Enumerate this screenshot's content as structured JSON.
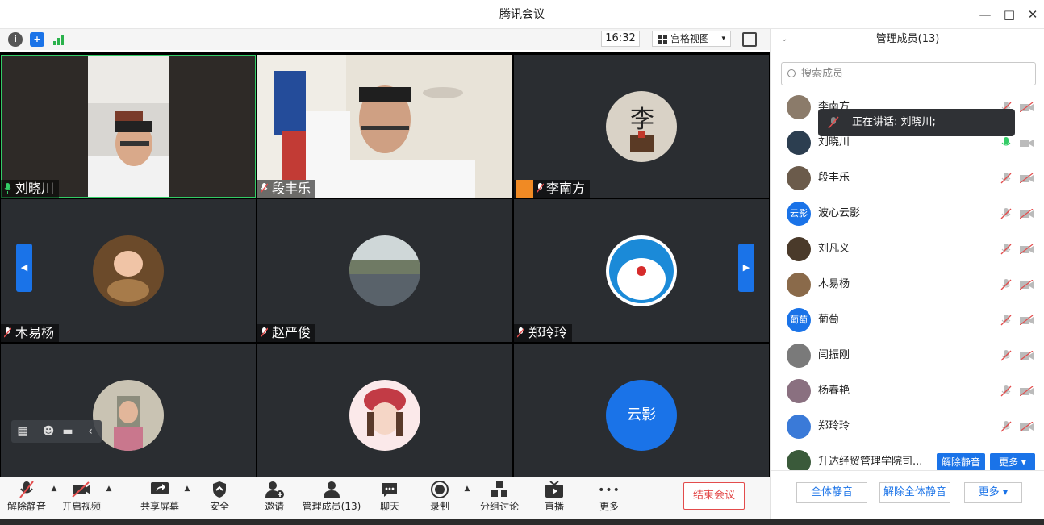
{
  "window": {
    "title": "腾讯会议",
    "minimize": "—",
    "maximize": "□",
    "close": "✕"
  },
  "topbar": {
    "time": "16:32",
    "view_label": "宫格视图",
    "view_caret": "▾"
  },
  "tiles": [
    {
      "name": "刘晓川",
      "active": true,
      "mic": "on"
    },
    {
      "name": "段丰乐",
      "active": false,
      "mic": "muted"
    },
    {
      "name": "李南方",
      "active": false,
      "mic": "muted",
      "badge": true
    },
    {
      "name": "木易杨",
      "active": false,
      "mic": "muted"
    },
    {
      "name": "赵严俊",
      "active": false,
      "mic": "muted"
    },
    {
      "name": "郑玲玲",
      "active": false,
      "mic": "muted"
    },
    {
      "name": "",
      "active": false,
      "mic": "muted"
    },
    {
      "name": "",
      "active": false,
      "mic": "muted"
    },
    {
      "name": "云影",
      "active": false,
      "mic": "muted"
    }
  ],
  "nav": {
    "prev": "◀",
    "next": "▶"
  },
  "toolbar": {
    "unmute": "解除静音",
    "start_video": "开启视频",
    "share": "共享屏幕",
    "security": "安全",
    "invite": "邀请",
    "members": "管理成员(13)",
    "chat": "聊天",
    "record": "录制",
    "breakout": "分组讨论",
    "live": "直播",
    "more": "更多",
    "end": "结束会议",
    "more_dots": "•••"
  },
  "sidebar": {
    "title": "管理成员(13)",
    "search_placeholder": "搜索成员",
    "members": [
      {
        "name": "李南方",
        "mic": "muted"
      },
      {
        "name": "刘晓川",
        "mic": "on"
      },
      {
        "name": "段丰乐",
        "mic": "muted"
      },
      {
        "name": "波心云影",
        "mic": "muted",
        "avatar_text": "云影"
      },
      {
        "name": "刘凡义",
        "mic": "muted"
      },
      {
        "name": "木易杨",
        "mic": "muted"
      },
      {
        "name": "葡萄",
        "mic": "muted",
        "avatar_text": "葡萄"
      },
      {
        "name": "闫振刚",
        "mic": "muted"
      },
      {
        "name": "杨春艳",
        "mic": "muted"
      },
      {
        "name": "郑玲玲",
        "mic": "muted"
      },
      {
        "name": "升达经贸管理学院司...",
        "mic": "muted"
      }
    ],
    "row_unmute": "解除静音",
    "row_more": "更多 ▾",
    "tooltip": "正在讲话: 刘晓川;",
    "mute_all": "全体静音",
    "unmute_all": "解除全体静音",
    "more": "更多 ▾"
  },
  "colors": {
    "accent": "#1a73e8",
    "active_border": "#33cc66",
    "end": "#e34c4c",
    "mic_on": "#33cc66",
    "mic_muted": "#e34c4c"
  }
}
